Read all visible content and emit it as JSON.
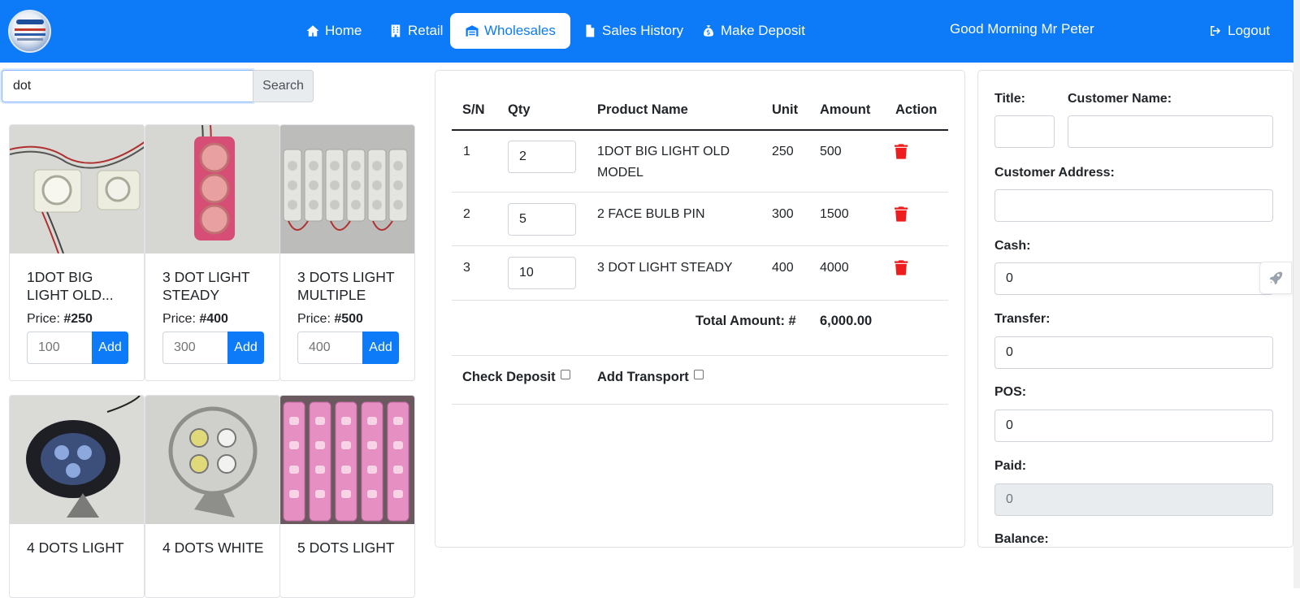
{
  "nav": {
    "items": [
      {
        "label": "Home",
        "icon": "home-icon"
      },
      {
        "label": "Retail",
        "icon": "building-icon"
      },
      {
        "label": "Wholesales",
        "icon": "warehouse-icon",
        "active": true
      },
      {
        "label": "Sales History",
        "icon": "file-icon"
      },
      {
        "label": "Make Deposit",
        "icon": "money-bag-icon"
      }
    ],
    "greeting": "Good Morning Mr Peter",
    "logout": "Logout"
  },
  "search": {
    "value": "dot",
    "button": "Search"
  },
  "products": [
    {
      "name": "1DOT BIG LIGHT OLD...",
      "price_label": "Price: ",
      "price": "#250",
      "qty_placeholder": "100",
      "add": "Add"
    },
    {
      "name": "3 DOT LIGHT STEADY",
      "price_label": "Price: ",
      "price": "#400",
      "qty_placeholder": "300",
      "add": "Add"
    },
    {
      "name": "3 DOTS LIGHT MULTIPLE",
      "price_label": "Price: ",
      "price": "#500",
      "qty_placeholder": "400",
      "add": "Add"
    },
    {
      "name": "4 DOTS LIGHT",
      "price_label": "",
      "price": "",
      "qty_placeholder": "",
      "add": ""
    },
    {
      "name": "4 DOTS WHITE",
      "price_label": "",
      "price": "",
      "qty_placeholder": "",
      "add": ""
    },
    {
      "name": "5 DOTS LIGHT",
      "price_label": "",
      "price": "",
      "qty_placeholder": "",
      "add": ""
    }
  ],
  "cart": {
    "headers": {
      "sn": "S/N",
      "qty": "Qty",
      "product": "Product Name",
      "unit": "Unit",
      "amount": "Amount",
      "action": "Action"
    },
    "rows": [
      {
        "sn": "1",
        "qty": "2",
        "product": "1DOT BIG LIGHT OLD MODEL",
        "unit": "250",
        "amount": "500"
      },
      {
        "sn": "2",
        "qty": "5",
        "product": "2 FACE BULB PIN",
        "unit": "300",
        "amount": "1500"
      },
      {
        "sn": "3",
        "qty": "10",
        "product": "3 DOT LIGHT STEADY",
        "unit": "400",
        "amount": "4000"
      }
    ],
    "total_label": "Total Amount: #",
    "total_value": "6,000.00",
    "check_deposit": "Check Deposit",
    "add_transport": "Add Transport"
  },
  "form": {
    "title_label": "Title:",
    "customer_name_label": "Customer Name:",
    "customer_address_label": "Customer Address:",
    "cash_label": "Cash:",
    "cash_value": "0",
    "transfer_label": "Transfer:",
    "transfer_value": "0",
    "pos_label": "POS:",
    "pos_value": "0",
    "paid_label": "Paid:",
    "paid_value": "0",
    "balance_label": "Balance:"
  },
  "colors": {
    "primary": "#0d7bf7",
    "danger": "#ee1c1c"
  }
}
